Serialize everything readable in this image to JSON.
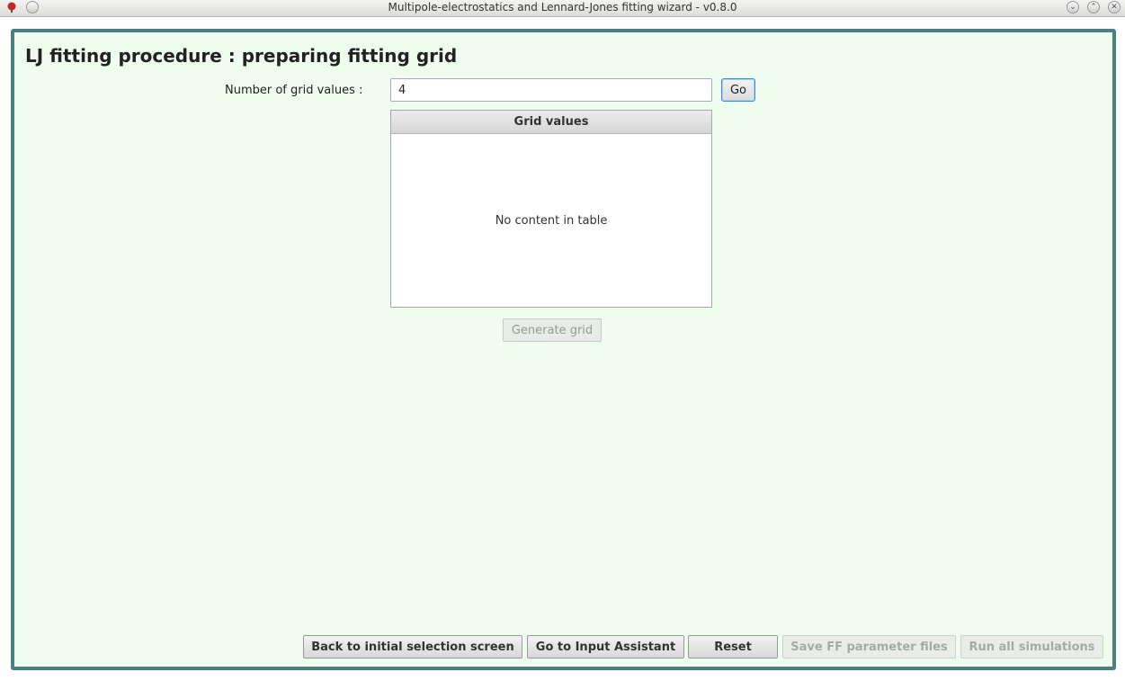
{
  "window": {
    "title": "Multipole-electrostatics and Lennard-Jones fitting wizard - v0.8.0",
    "minimize_glyph": "⌄",
    "maximize_glyph": "⌃",
    "close_glyph": "✕"
  },
  "page": {
    "title": "LJ fitting procedure : preparing fitting grid"
  },
  "grid": {
    "label": "Number of grid values :",
    "input_value": "4",
    "go_label": "Go",
    "table_header": "Grid values",
    "empty_text": "No content in table",
    "generate_label": "Generate grid"
  },
  "footer": {
    "back_label": "Back to initial selection screen",
    "input_assistant_label": "Go to Input Assistant",
    "reset_label": "Reset",
    "save_label": "Save FF parameter files",
    "run_label": "Run all simulations"
  },
  "colors": {
    "panel_background": "#effdef",
    "frame_border": "#4a8080",
    "focus_accent": "#3b8fc9"
  },
  "icons": [
    "app-icon",
    "window-menu-icon",
    "minimize-icon",
    "maximize-icon",
    "close-icon"
  ]
}
